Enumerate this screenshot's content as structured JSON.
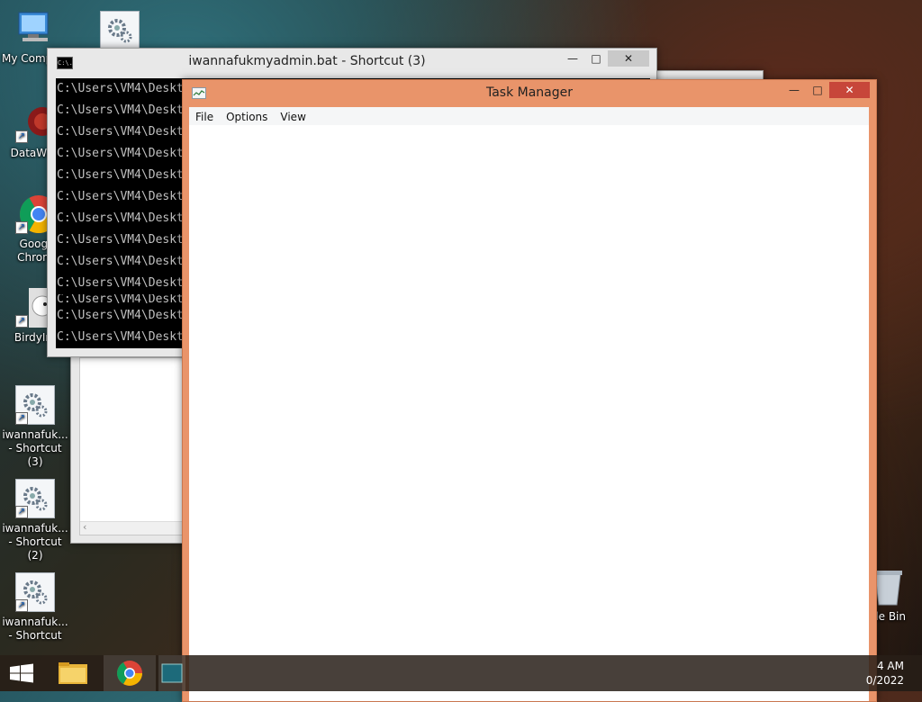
{
  "desktop": {
    "icons": [
      {
        "label": "My Comp",
        "label2": ""
      },
      {
        "label": "",
        "label2": ""
      },
      {
        "label": "DataWag",
        "label2": ""
      },
      {
        "label": "Googl",
        "label2": "Chrom"
      },
      {
        "label": "BirdyIm",
        "label2": ""
      },
      {
        "label": "iwannafuk...",
        "label2": "- Shortcut (3)"
      },
      {
        "label": "iwannafuk...",
        "label2": "- Shortcut (2)"
      },
      {
        "label": "iwannafuk...",
        "label2": "- Shortcut"
      },
      {
        "label": "cle Bin",
        "label2": ""
      }
    ]
  },
  "cmd": {
    "title": "iwannafukmyadmin.bat - Shortcut (3)",
    "icon_text": "C:\\.",
    "controls": {
      "minimize": "—",
      "maximize": "□",
      "close": "✕"
    },
    "lines": [
      "C:\\Users\\VM4\\Deskt",
      "C:\\Users\\VM4\\Deskt",
      "C:\\Users\\VM4\\Deskt",
      "C:\\Users\\VM4\\Deskt",
      "C:\\Users\\VM4\\Deskt",
      "C:\\Users\\VM4\\Deskt",
      "C:\\Users\\VM4\\Deskt",
      "C:\\Users\\VM4\\Deskt",
      "C:\\Users\\VM4\\Deskt",
      "C:\\Users\\VM4\\Deskt",
      "C:\\Users\\VM4\\Deskt",
      "C:\\Users\\VM4\\Deskt",
      "C:\\Users\\VM4\\Deskt"
    ]
  },
  "taskmgr": {
    "title": "Task Manager",
    "controls": {
      "minimize": "—",
      "maximize": "□",
      "close": "✕"
    },
    "menu": [
      "File",
      "Options",
      "View"
    ]
  },
  "taskbar": {
    "time": "4 AM",
    "date": "0/2022"
  },
  "colors": {
    "taskmgr_frame": "#e9946a",
    "close_red": "#c7463a",
    "console_bg": "#000000"
  }
}
